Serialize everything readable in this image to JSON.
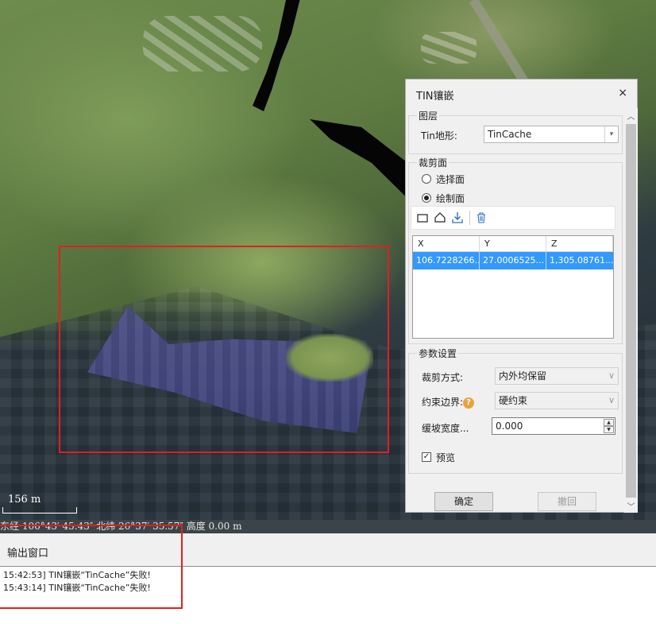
{
  "scene": {
    "scale_label": "156 m",
    "status_text": "东经 106°43′ 45.43″  北纬 26°37′ 35.57″  高度 0.00 m"
  },
  "dialog": {
    "title": "TIN镶嵌",
    "close_glyph": "×",
    "layer_group": {
      "title": "图层",
      "tin_label": "Tin地形:",
      "tin_value": "TinCache",
      "dropdown_glyph": "▾"
    },
    "clip_group": {
      "title": "裁剪面",
      "option_select": "选择面",
      "option_draw": "绘制面",
      "selected_option": "绘制面",
      "table": {
        "columns": [
          "X",
          "Y",
          "Z"
        ],
        "rows": [
          [
            "106.7228266...",
            "27.0006525...",
            "1,305.08761..."
          ]
        ]
      }
    },
    "params_group": {
      "title": "参数设置",
      "clip_mode_label": "裁剪方式:",
      "clip_mode_value": "内外均保留",
      "boundary_label": "约束边界:",
      "boundary_value": "硬约束",
      "slope_width_label": "缓坡宽度...",
      "slope_width_value": "0.000",
      "preview_label": "预览",
      "preview_checked": true,
      "help_glyph": "?",
      "combo_glyph": "∨"
    },
    "buttons": {
      "ok": "确定",
      "undo": "撤回"
    }
  },
  "output": {
    "title": "输出窗口",
    "lines": [
      "15:42:53] TIN镶嵌“TinCache”失败!",
      "15:43:14] TIN镶嵌“TinCache”失败!"
    ]
  },
  "colors": {
    "accent_selection": "#3399ff",
    "highlight_border": "#e02020",
    "help_icon": "#e8a33c"
  }
}
